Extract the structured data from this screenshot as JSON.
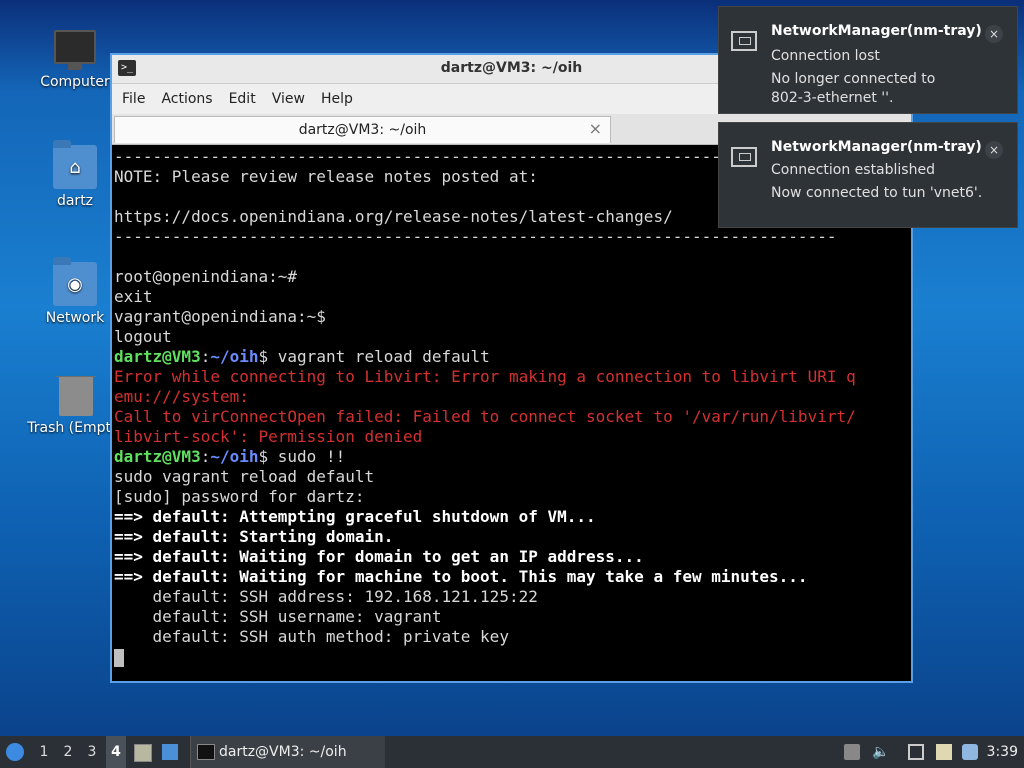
{
  "desktop": {
    "icons": [
      {
        "label": "Computer"
      },
      {
        "label": "dartz"
      },
      {
        "label": "Network"
      },
      {
        "label": "Trash (Empty)"
      }
    ]
  },
  "window": {
    "title": "dartz@VM3: ~/oih",
    "menu": [
      "File",
      "Actions",
      "Edit",
      "View",
      "Help"
    ],
    "tab_label": "dartz@VM3: ~/oih",
    "tab_close": "×"
  },
  "terminal": {
    "lines": [
      {
        "segments": [
          {
            "t": "----------------------------------------------------------------------------------",
            "c": ""
          }
        ]
      },
      {
        "segments": [
          {
            "t": "NOTE: Please review release notes posted at:",
            "c": ""
          }
        ]
      },
      {
        "segments": [
          {
            "t": "",
            "c": ""
          }
        ]
      },
      {
        "segments": [
          {
            "t": "https://docs.openindiana.org/release-notes/latest-changes/",
            "c": ""
          }
        ]
      },
      {
        "segments": [
          {
            "t": "---------------------------------------------------------------------------",
            "c": ""
          }
        ]
      },
      {
        "segments": [
          {
            "t": "",
            "c": ""
          }
        ]
      },
      {
        "segments": [
          {
            "t": "root@openindiana:~#",
            "c": ""
          }
        ]
      },
      {
        "segments": [
          {
            "t": "exit",
            "c": ""
          }
        ]
      },
      {
        "segments": [
          {
            "t": "vagrant@openindiana:~$",
            "c": ""
          }
        ]
      },
      {
        "segments": [
          {
            "t": "logout",
            "c": ""
          }
        ]
      },
      {
        "segments": [
          {
            "t": "dartz@VM3",
            "c": "green"
          },
          {
            "t": ":",
            "c": ""
          },
          {
            "t": "~/oih",
            "c": "blue"
          },
          {
            "t": "$ vagrant reload default",
            "c": ""
          }
        ]
      },
      {
        "segments": [
          {
            "t": "Error while connecting to Libvirt: Error making a connection to libvirt URI q",
            "c": "red"
          }
        ]
      },
      {
        "segments": [
          {
            "t": "emu:///system:",
            "c": "red"
          }
        ]
      },
      {
        "segments": [
          {
            "t": "Call to virConnectOpen failed: Failed to connect socket to '/var/run/libvirt/",
            "c": "red"
          }
        ]
      },
      {
        "segments": [
          {
            "t": "libvirt-sock': Permission denied",
            "c": "red"
          }
        ]
      },
      {
        "segments": [
          {
            "t": "dartz@VM3",
            "c": "green"
          },
          {
            "t": ":",
            "c": ""
          },
          {
            "t": "~/oih",
            "c": "blue"
          },
          {
            "t": "$ sudo !!",
            "c": ""
          }
        ]
      },
      {
        "segments": [
          {
            "t": "sudo vagrant reload default",
            "c": ""
          }
        ]
      },
      {
        "segments": [
          {
            "t": "[sudo] password for dartz:",
            "c": ""
          }
        ]
      },
      {
        "segments": [
          {
            "t": "==> default: Attempting graceful shutdown of VM...",
            "c": "bold"
          }
        ]
      },
      {
        "segments": [
          {
            "t": "==> default: Starting domain.",
            "c": "bold"
          }
        ]
      },
      {
        "segments": [
          {
            "t": "==> default: Waiting for domain to get an IP address...",
            "c": "bold"
          }
        ]
      },
      {
        "segments": [
          {
            "t": "==> default: Waiting for machine to boot. This may take a few minutes...",
            "c": "bold"
          }
        ]
      },
      {
        "segments": [
          {
            "t": "    default: SSH address: 192.168.121.125:22",
            "c": ""
          }
        ]
      },
      {
        "segments": [
          {
            "t": "    default: SSH username: vagrant",
            "c": ""
          }
        ]
      },
      {
        "segments": [
          {
            "t": "    default: SSH auth method: private key",
            "c": ""
          }
        ]
      }
    ]
  },
  "notifications": [
    {
      "title": "NetworkManager(nm-tray)",
      "line1": "Connection lost",
      "line2": "No longer connected to",
      "line3": "802-3-ethernet ''.",
      "close": "×"
    },
    {
      "title": "NetworkManager(nm-tray)",
      "line1": "Connection established",
      "line2": "Now connected to tun 'vnet6'.",
      "close": "×"
    }
  ],
  "taskbar": {
    "workspaces": [
      "1",
      "2",
      "3",
      "4"
    ],
    "task_label": "dartz@VM3: ~/oih",
    "clock": "3:39"
  }
}
